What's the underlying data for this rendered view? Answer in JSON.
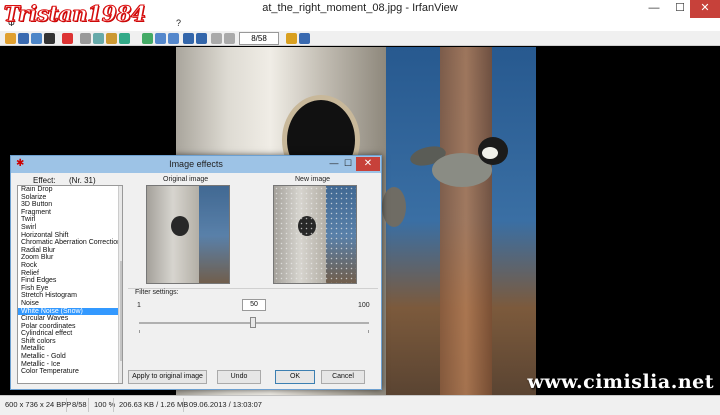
{
  "window": {
    "title": "at_the_right_moment_08.jpg - IrfanView",
    "logo": "Tristan1984",
    "minimize": "—",
    "maximize": "☐",
    "close": "✕"
  },
  "menu": {
    "items": [
      "Ф",
      "?"
    ]
  },
  "toolbar": {
    "counter": "8/58",
    "icons": [
      "open-icon",
      "save-icon",
      "thumbnails-icon",
      "delete-icon",
      "cut-icon",
      "copy-icon",
      "paste-icon",
      "undo-icon",
      "info-icon",
      "zoom-in-icon",
      "zoom-out-icon",
      "prev-icon",
      "next-icon",
      "prev-folder-icon",
      "next-folder-icon",
      "edit-icon",
      "settings-icon"
    ]
  },
  "status": {
    "dimensions": "600 x 736 x 24 BPP",
    "index": "8/58",
    "zoom": "100 %",
    "size": "206.63 KB / 1.26 MB",
    "datetime": "09.06.2013 / 13:03:07"
  },
  "watermark": "www.cimislia.net",
  "dialog": {
    "title": "Image effects",
    "effect_label": "Effect:",
    "effect_number": "(Nr. 31)",
    "original_caption": "Original image",
    "new_caption": "New image",
    "filter_label": "Filter settings:",
    "slider": {
      "min": "1",
      "max": "100",
      "value": "50",
      "value_num": 50,
      "min_num": 1,
      "max_num": 100
    },
    "effects": [
      "Rain Drop",
      "Solarize",
      "3D Button",
      "Fragment",
      "Twirl",
      "Swirl",
      "Horizontal Shift",
      "Chromatic Aberration Correction",
      "Radial Blur",
      "Zoom Blur",
      "Rock",
      "Relief",
      "Find Edges",
      "Fish Eye",
      "Stretch Histogram",
      "Noise",
      "White Noise (Snow)",
      "Circular Waves",
      "Polar coordinates",
      "Cylindrical effect",
      "Shift colors",
      "Metallic",
      "Metallic - Gold",
      "Metallic - Ice",
      "Color Temperature"
    ],
    "selected_index": 16,
    "buttons": {
      "apply": "Apply to original image",
      "undo": "Undo",
      "ok": "OK",
      "cancel": "Cancel"
    }
  },
  "colors": {
    "accent": "#3399ff",
    "close_red": "#c7413a",
    "dialog_title": "#9dc3e6"
  }
}
